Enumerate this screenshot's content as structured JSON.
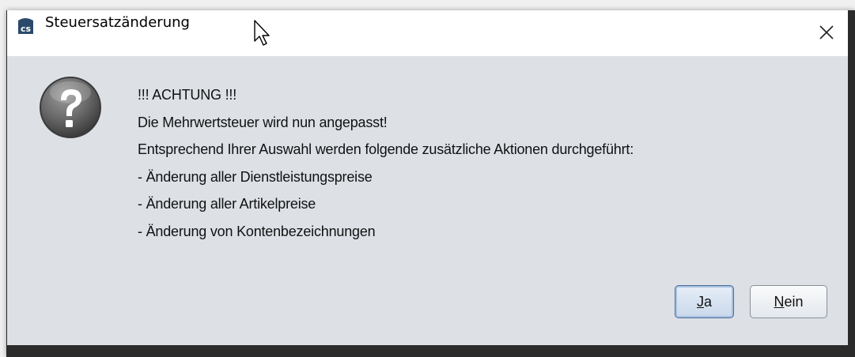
{
  "window": {
    "title": "Steuersatzänderung",
    "close_symbol": "✕"
  },
  "icons": {
    "app": "cs-logo-icon",
    "dialog": "question-icon",
    "cursor": "mouse-pointer-icon"
  },
  "message": {
    "lines": [
      "!!! ACHTUNG !!!",
      "Die Mehrwertsteuer wird nun angepasst!",
      "Entsprechend Ihrer Auswahl werden folgende zusätzliche Aktionen durchgeführt:",
      "- Änderung aller Dienstleistungspreise",
      "- Änderung aller Artikelpreise",
      "- Änderung von Kontenbezeichnungen"
    ]
  },
  "buttons": {
    "yes": {
      "mnemonic": "J",
      "rest": "a"
    },
    "no": {
      "mnemonic": "N",
      "rest": "ein"
    }
  },
  "colors": {
    "content_bg": "#dde1e6",
    "title_bg": "#ffffff",
    "default_button_border": "#4a6f9c"
  }
}
